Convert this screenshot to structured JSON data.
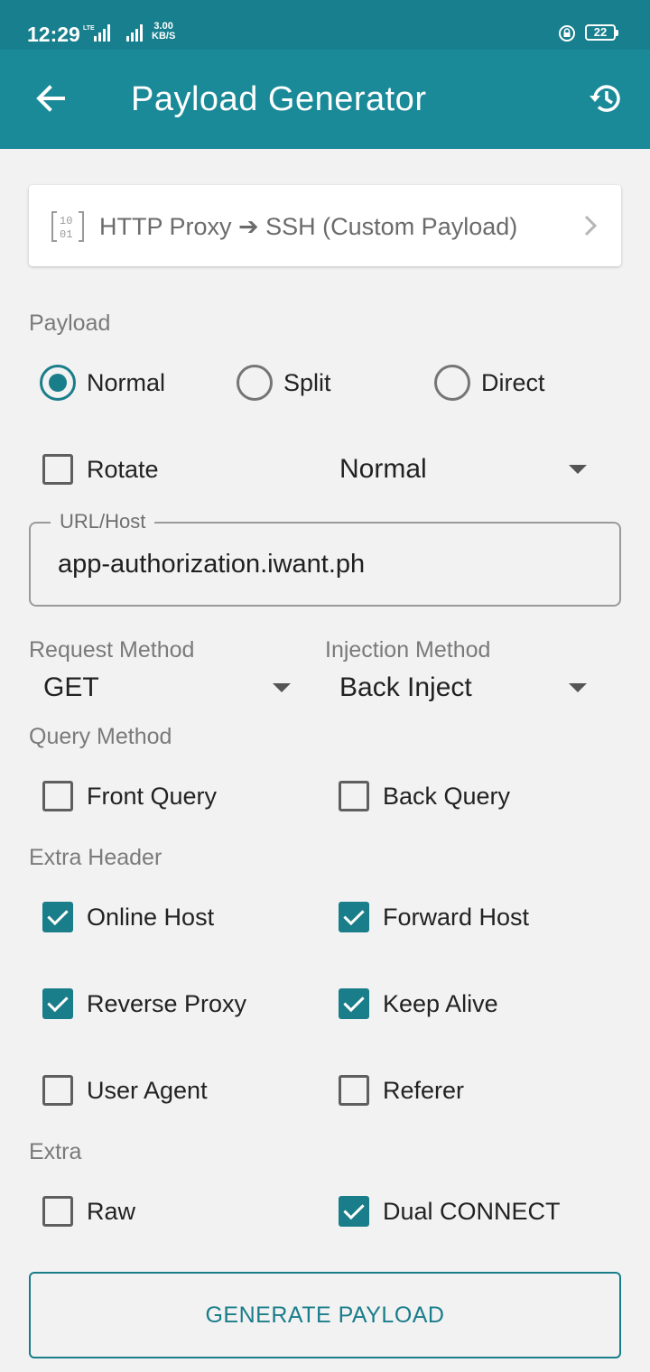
{
  "status_bar": {
    "time": "12:29",
    "lte_label": "LTE",
    "net_speed_value": "3.00",
    "net_speed_unit": "KB/S",
    "battery_level": "22"
  },
  "app_bar": {
    "title": "Payload Generator",
    "back_icon": "arrow-left-icon",
    "history_icon": "history-icon"
  },
  "mode_selector": {
    "icon": "binary-icon",
    "label": "HTTP Proxy ➔ SSH (Custom Payload)"
  },
  "payload": {
    "section_label": "Payload",
    "options": [
      {
        "label": "Normal",
        "checked": true
      },
      {
        "label": "Split",
        "checked": false
      },
      {
        "label": "Direct",
        "checked": false
      }
    ],
    "rotate_label": "Rotate",
    "rotate_checked": false,
    "rotate_mode_value": "Normal"
  },
  "url_host": {
    "legend": "URL/Host",
    "value": "app-authorization.iwant.ph"
  },
  "request_method": {
    "label": "Request Method",
    "value": "GET"
  },
  "injection_method": {
    "label": "Injection Method",
    "value": "Back Inject"
  },
  "query_method": {
    "section_label": "Query Method",
    "options": [
      {
        "label": "Front Query",
        "checked": false
      },
      {
        "label": "Back Query",
        "checked": false
      }
    ]
  },
  "extra_header": {
    "section_label": "Extra Header",
    "options": [
      {
        "label": "Online Host",
        "checked": true
      },
      {
        "label": "Forward Host",
        "checked": true
      },
      {
        "label": "Reverse Proxy",
        "checked": true
      },
      {
        "label": "Keep Alive",
        "checked": true
      },
      {
        "label": "User Agent",
        "checked": false
      },
      {
        "label": "Referer",
        "checked": false
      }
    ]
  },
  "extra": {
    "section_label": "Extra",
    "options": [
      {
        "label": "Raw",
        "checked": false
      },
      {
        "label": "Dual CONNECT",
        "checked": true
      }
    ]
  },
  "generate_button_label": "GENERATE PAYLOAD",
  "colors": {
    "app_bar": "#1a8a98",
    "status_bar": "#177f8d",
    "accent": "#1a7d8a",
    "background": "#f2f2f2"
  }
}
